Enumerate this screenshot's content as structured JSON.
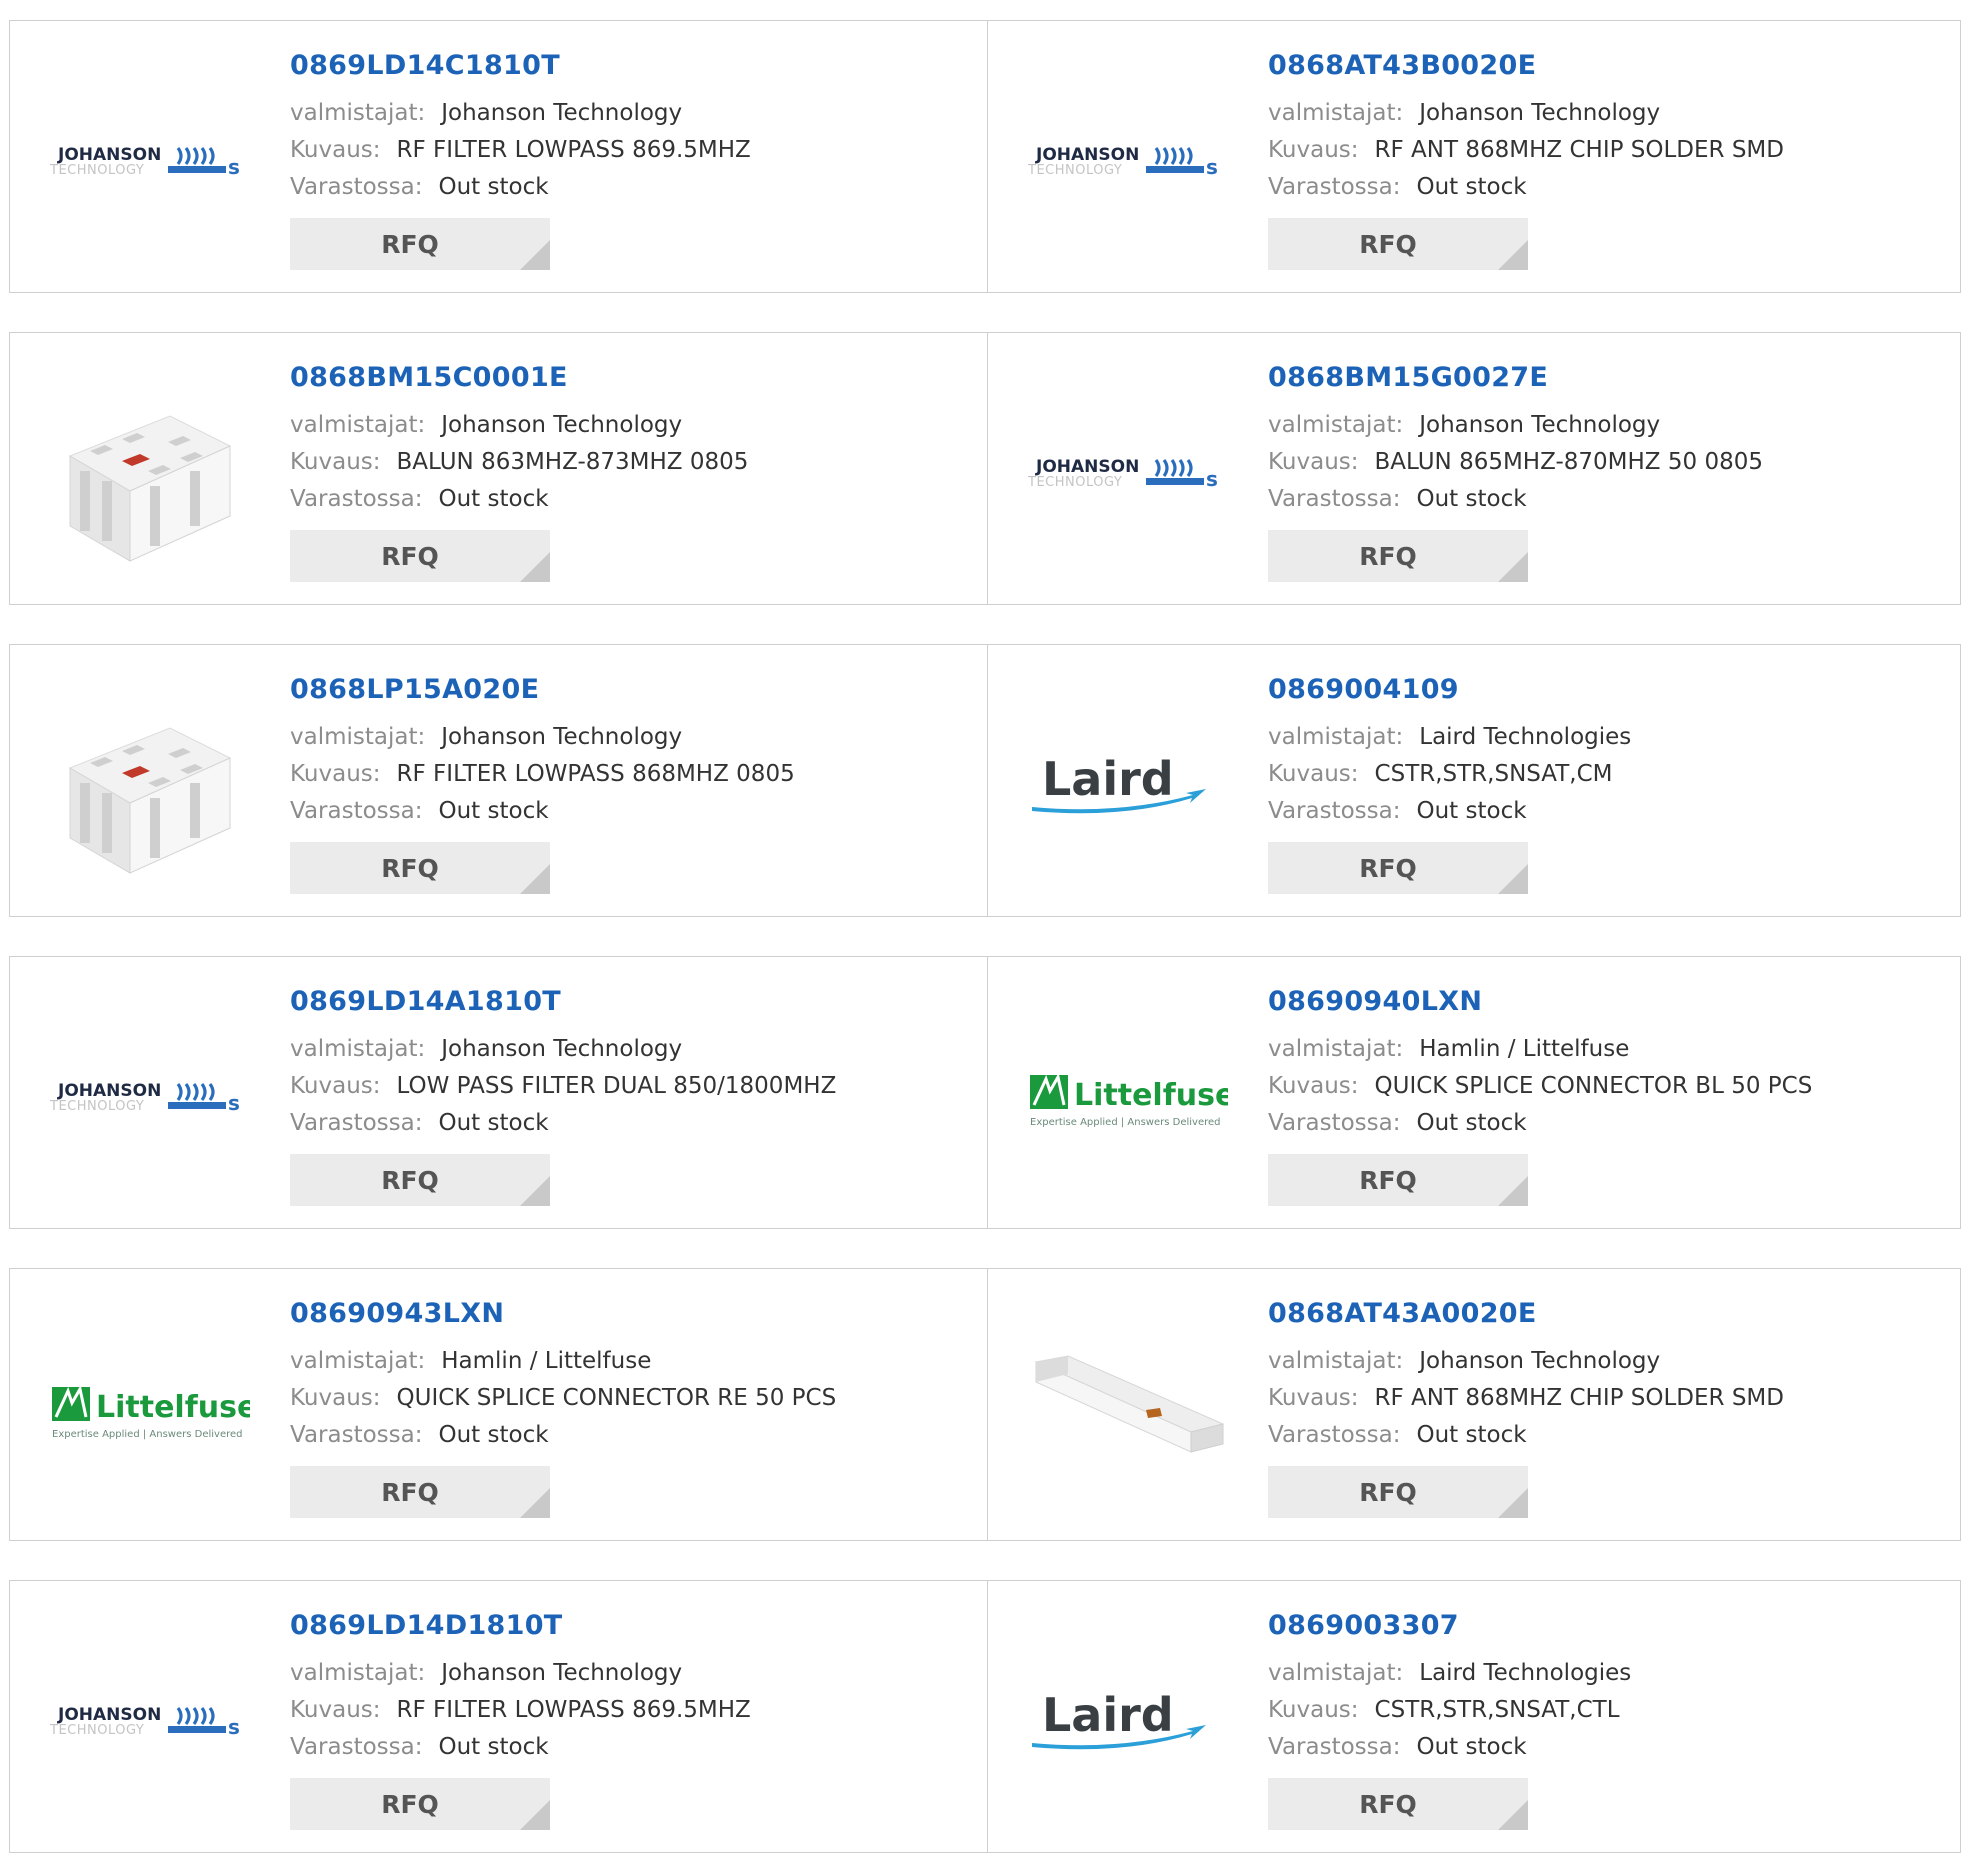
{
  "labels": {
    "manufacturer": "valmistajat:",
    "description": "Kuvaus:",
    "stock": "Varastossa:",
    "rfq": "RFQ"
  },
  "logos": {
    "johanson": {
      "line1": "JOHANSON",
      "line2": "TECHNOLOGY"
    },
    "laird": {
      "text": "Laird"
    },
    "littelfuse": {
      "text": "Littelfuse",
      "tagline": "Expertise Applied | Answers Delivered"
    }
  },
  "colors": {
    "part_link": "#1c63b8",
    "label_gray": "#8c8c8c",
    "button_bg": "#ebebeb",
    "laird_blue": "#2a9fd8",
    "littelfuse_green": "#1a9a3c"
  },
  "products": [
    {
      "part": "0869LD14C1810T",
      "manufacturer": "Johanson Technology",
      "description": "RF FILTER LOWPASS 869.5MHZ",
      "stock": "Out stock",
      "image": "johanson-logo"
    },
    {
      "part": "0868AT43B0020E",
      "manufacturer": "Johanson Technology",
      "description": "RF ANT 868MHZ CHIP SOLDER SMD",
      "stock": "Out stock",
      "image": "johanson-logo"
    },
    {
      "part": "0868BM15C0001E",
      "manufacturer": "Johanson Technology",
      "description": "BALUN 863MHZ-873MHZ 0805",
      "stock": "Out stock",
      "image": "chip-component-photo"
    },
    {
      "part": "0868BM15G0027E",
      "manufacturer": "Johanson Technology",
      "description": "BALUN 865MHZ-870MHZ 50 0805",
      "stock": "Out stock",
      "image": "johanson-logo"
    },
    {
      "part": "0868LP15A020E",
      "manufacturer": "Johanson Technology",
      "description": "RF FILTER LOWPASS 868MHZ 0805",
      "stock": "Out stock",
      "image": "chip-component-photo"
    },
    {
      "part": "0869004109",
      "manufacturer": "Laird Technologies",
      "description": "CSTR,STR,SNSAT,CM",
      "stock": "Out stock",
      "image": "laird-logo"
    },
    {
      "part": "0869LD14A1810T",
      "manufacturer": "Johanson Technology",
      "description": "LOW PASS FILTER DUAL 850/1800MHZ",
      "stock": "Out stock",
      "image": "johanson-logo"
    },
    {
      "part": "08690940LXN",
      "manufacturer": "Hamlin / Littelfuse",
      "description": "QUICK SPLICE CONNECTOR BL 50 PCS",
      "stock": "Out stock",
      "image": "littelfuse-logo"
    },
    {
      "part": "08690943LXN",
      "manufacturer": "Hamlin / Littelfuse",
      "description": "QUICK SPLICE CONNECTOR RE 50 PCS",
      "stock": "Out stock",
      "image": "littelfuse-logo"
    },
    {
      "part": "0868AT43A0020E",
      "manufacturer": "Johanson Technology",
      "description": "RF ANT 868MHZ CHIP SOLDER SMD",
      "stock": "Out stock",
      "image": "chip-antenna-photo"
    },
    {
      "part": "0869LD14D1810T",
      "manufacturer": "Johanson Technology",
      "description": "RF FILTER LOWPASS 869.5MHZ",
      "stock": "Out stock",
      "image": "johanson-logo"
    },
    {
      "part": "0869003307",
      "manufacturer": "Laird Technologies",
      "description": "CSTR,STR,SNSAT,CTL",
      "stock": "Out stock",
      "image": "laird-logo"
    }
  ]
}
